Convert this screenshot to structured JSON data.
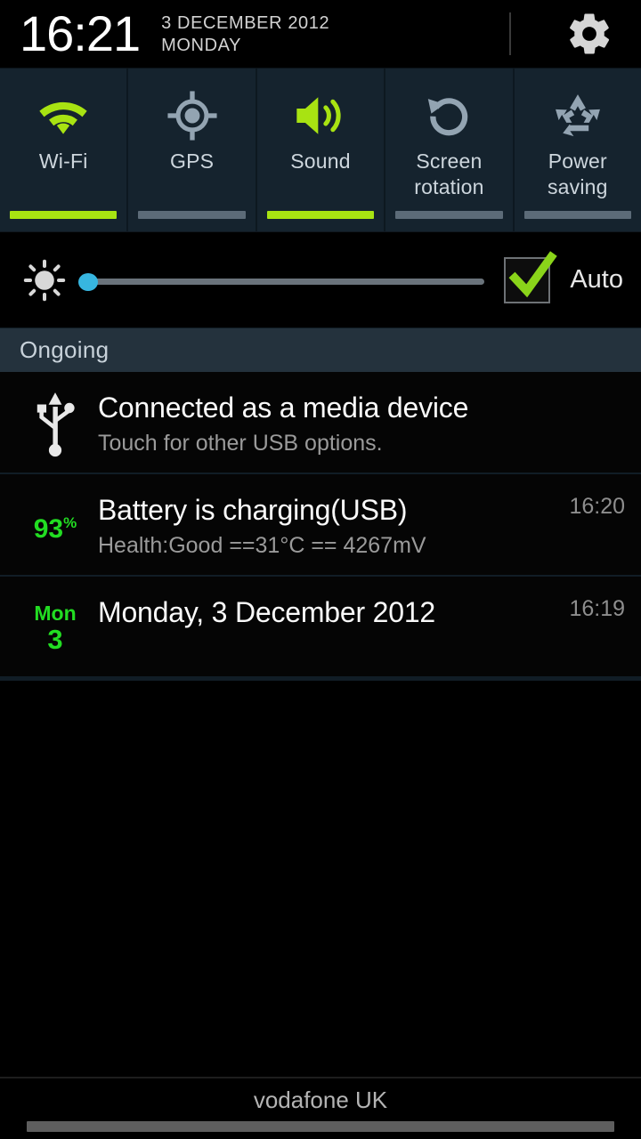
{
  "header": {
    "clock": "16:21",
    "date": "3 DECEMBER 2012",
    "weekday": "MONDAY",
    "settings_icon": "gear-icon"
  },
  "quick_toggles": [
    {
      "label": "Wi-Fi",
      "icon": "wifi-icon",
      "active": true
    },
    {
      "label": "GPS",
      "icon": "gps-icon",
      "active": false
    },
    {
      "label": "Sound",
      "icon": "speaker-icon",
      "active": true
    },
    {
      "label": "Screen\nrotation",
      "icon": "screen-rotation-icon",
      "active": false
    },
    {
      "label": "Power\nsaving",
      "icon": "recycle-icon",
      "active": false
    }
  ],
  "toggle_labels": {
    "wifi": "Wi-Fi",
    "gps": "GPS",
    "sound": "Sound",
    "rotation_line1": "Screen",
    "rotation_line2": "rotation",
    "power_line1": "Power",
    "power_line2": "saving"
  },
  "brightness": {
    "icon": "brightness-icon",
    "value_percent": 2,
    "auto_label": "Auto",
    "auto_checked": true
  },
  "sections": {
    "ongoing_label": "Ongoing"
  },
  "notifications": [
    {
      "icon": "usb-icon",
      "title": "Connected as a media device",
      "subtitle": "Touch for other USB options.",
      "time": ""
    },
    {
      "icon": "battery-percent-icon",
      "badge_value": "93",
      "badge_unit": "%",
      "title": "Battery is charging(USB)",
      "subtitle": "Health:Good ==31°C == 4267mV",
      "time": "16:20"
    },
    {
      "icon": "calendar-icon",
      "badge_dow": "Mon",
      "badge_day": "3",
      "title": "Monday, 3 December 2012",
      "subtitle": "",
      "time": "16:19"
    }
  ],
  "footer": {
    "carrier": "vodafone UK",
    "handle": "drag-handle"
  },
  "colors": {
    "accent_green": "#a8e312",
    "status_green": "#22dd22",
    "panel_bg": "#15232e",
    "section_bg": "#24323d",
    "inactive_bar": "#5c6b78",
    "slider_thumb": "#37b6e0"
  }
}
